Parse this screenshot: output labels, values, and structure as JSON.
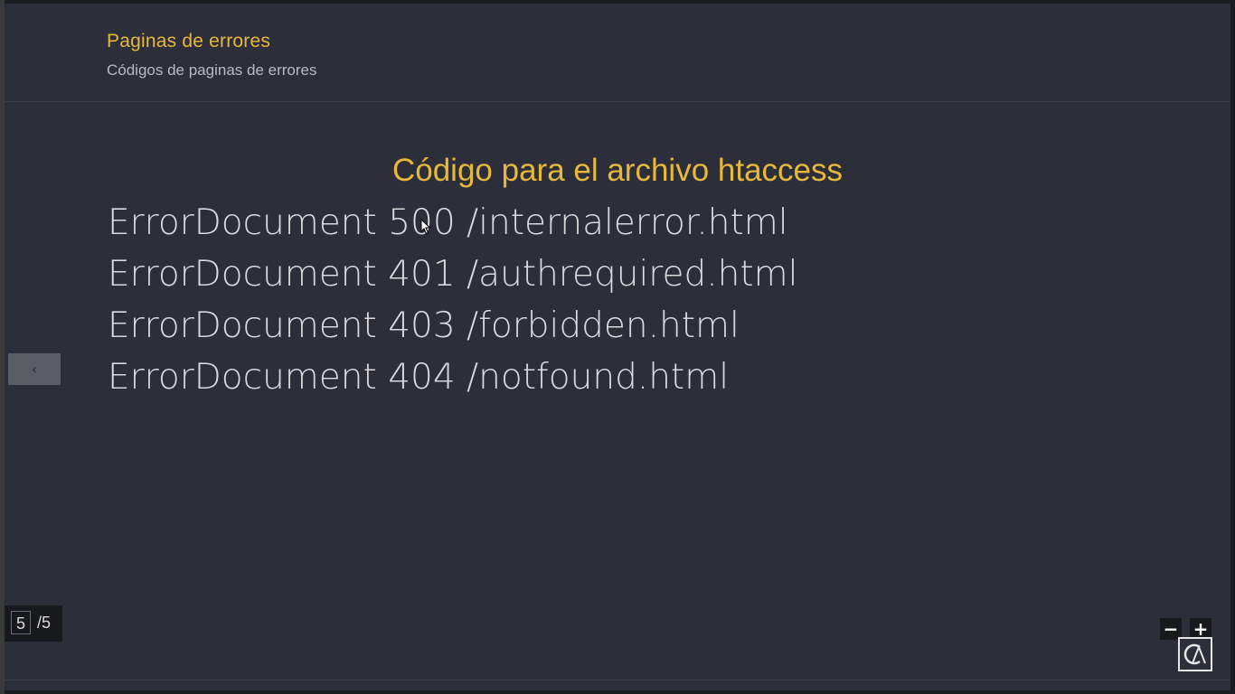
{
  "header": {
    "title": "Paginas de errores",
    "subtitle": "Códigos de paginas de errores"
  },
  "slide": {
    "heading": "Código para el archivo htaccess",
    "code_lines": [
      "ErrorDocument 500 /internalerror.html",
      "ErrorDocument 401 /authrequired.html",
      "ErrorDocument 403 /forbidden.html",
      "ErrorDocument 404 /notfound.html"
    ]
  },
  "navigation": {
    "prev_label": "‹",
    "current_page": "5",
    "total_pages": "/5"
  },
  "zoom": {
    "minus_label": "−",
    "plus_label": "+"
  },
  "colors": {
    "background": "#2c2e3a",
    "accent": "#e8b83a",
    "text": "#d9dade"
  }
}
